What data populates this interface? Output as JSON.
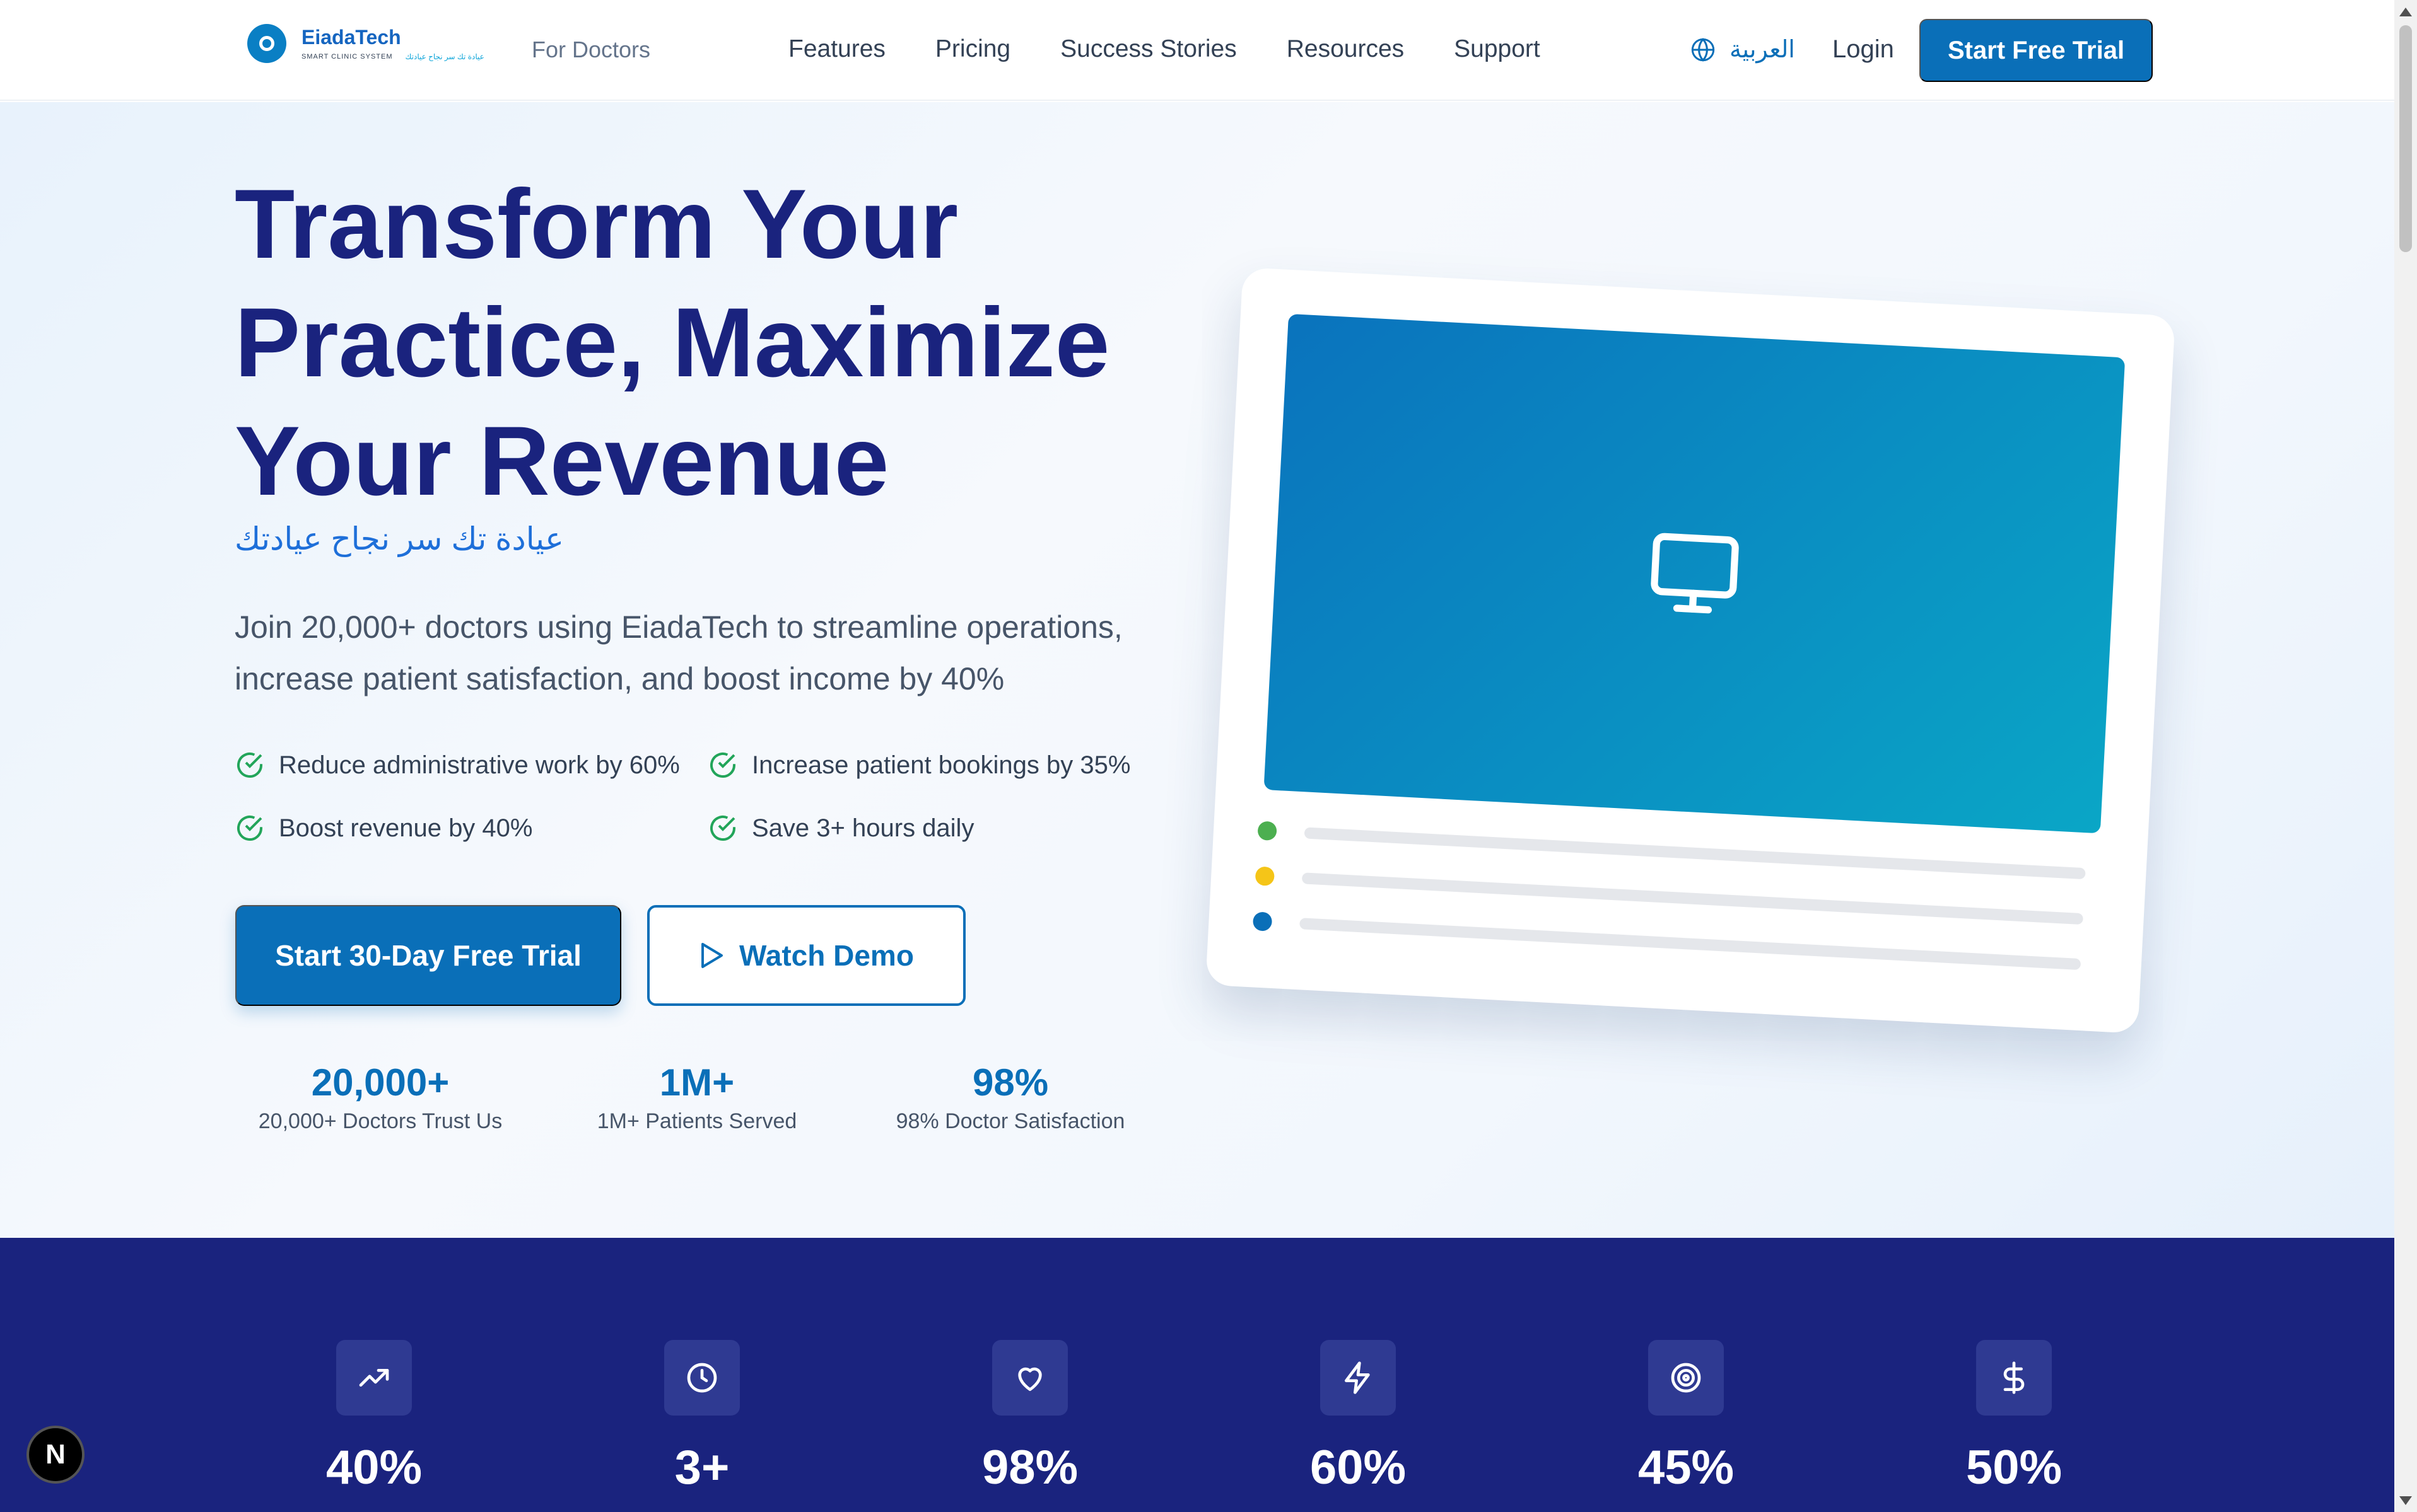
{
  "header": {
    "logo_name": "EiadaTech",
    "logo_tagline": "SMART CLINIC SYSTEM",
    "logo_arabic": "عيادة تك سر نجاح عيادتك",
    "for_doctors": "For Doctors",
    "nav": [
      "Features",
      "Pricing",
      "Success Stories",
      "Resources",
      "Support"
    ],
    "language": "العربية",
    "login": "Login",
    "cta": "Start Free Trial"
  },
  "hero": {
    "title_line1": "Transform Your",
    "title_line2": "Practice, Maximize",
    "title_line3": "Your Revenue",
    "arabic_tagline": "عيادة تك سر نجاح عيادتك",
    "subtitle": "Join 20,000+ doctors using EiadaTech to streamline operations, increase patient satisfaction, and boost income by 40%",
    "benefits": [
      "Reduce administrative work by 60%",
      "Increase patient bookings by 35%",
      "Boost revenue by 40%",
      "Save 3+ hours daily"
    ],
    "primary_button": "Start 30-Day Free Trial",
    "secondary_button": "Watch Demo",
    "stats": [
      {
        "value": "20,000+",
        "label": "20,000+ Doctors Trust Us"
      },
      {
        "value": "1M+",
        "label": "1M+ Patients Served"
      },
      {
        "value": "98%",
        "label": "98% Doctor Satisfaction"
      }
    ]
  },
  "mock": {
    "dot_colors": [
      "#4caf50",
      "#f5c518",
      "#0a6fb8"
    ]
  },
  "band": {
    "items": [
      {
        "icon": "trending-up-icon",
        "value": "40%"
      },
      {
        "icon": "clock-icon",
        "value": "3+"
      },
      {
        "icon": "heart-icon",
        "value": "98%"
      },
      {
        "icon": "lightning-icon",
        "value": "60%"
      },
      {
        "icon": "target-icon",
        "value": "45%"
      },
      {
        "icon": "dollar-icon",
        "value": "50%"
      }
    ]
  },
  "dev_badge": "N",
  "colors": {
    "brand_primary": "#0a6fb8",
    "heading_navy": "#1a237e",
    "band_background": "#1a237e",
    "check_green": "#22a55a"
  }
}
